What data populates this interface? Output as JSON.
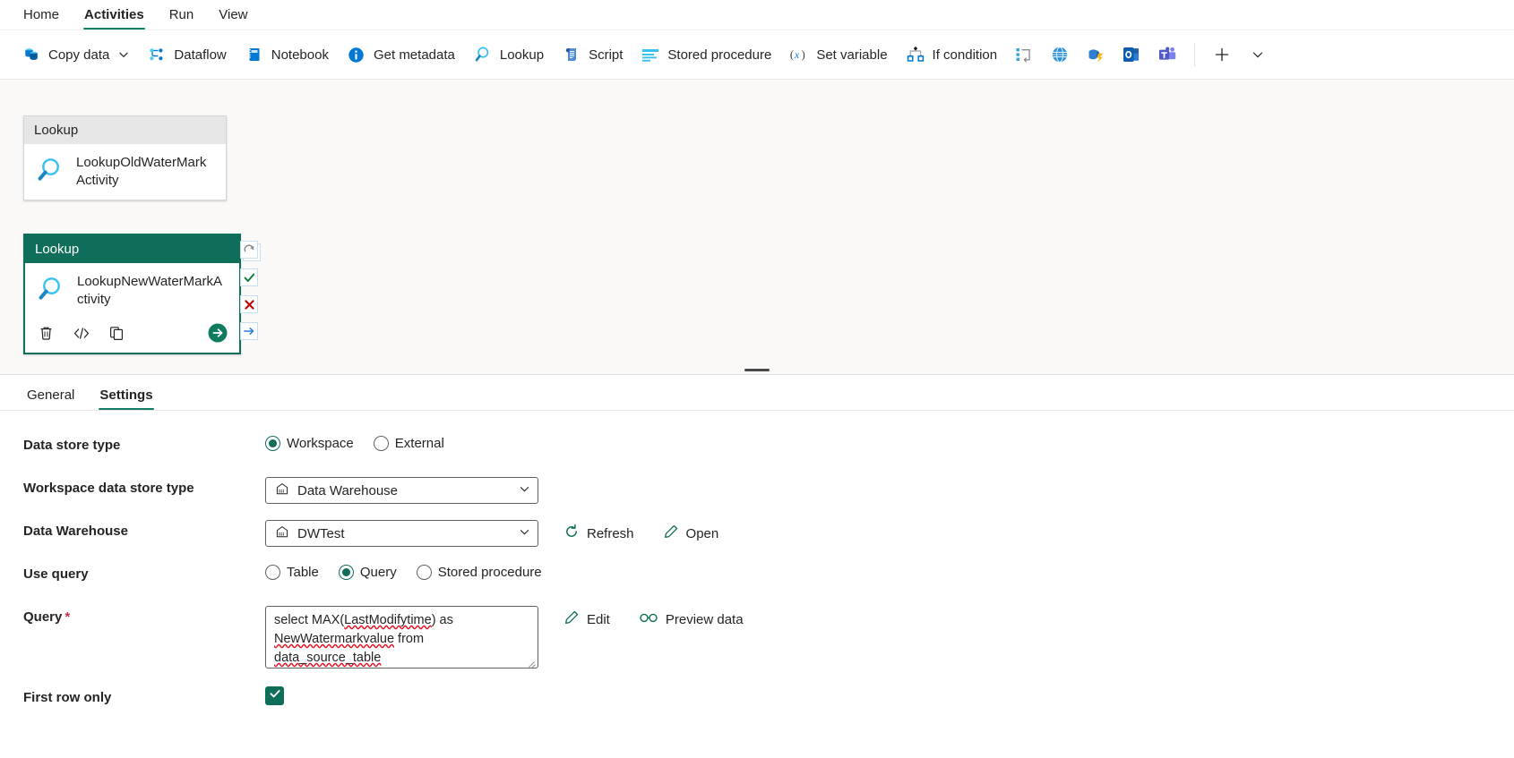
{
  "ribbon": {
    "tabs": [
      {
        "label": "Home",
        "active": false
      },
      {
        "label": "Activities",
        "active": true
      },
      {
        "label": "Run",
        "active": false
      },
      {
        "label": "View",
        "active": false
      }
    ]
  },
  "commandbar": {
    "items": [
      {
        "label": "Copy data",
        "icon": "copy-data-icon",
        "has_chevron": true
      },
      {
        "label": "Dataflow",
        "icon": "dataflow-icon",
        "has_chevron": false
      },
      {
        "label": "Notebook",
        "icon": "notebook-icon",
        "has_chevron": false
      },
      {
        "label": "Get metadata",
        "icon": "info-icon",
        "has_chevron": false
      },
      {
        "label": "Lookup",
        "icon": "magnifier-icon",
        "has_chevron": false
      },
      {
        "label": "Script",
        "icon": "script-icon",
        "has_chevron": false
      },
      {
        "label": "Stored procedure",
        "icon": "stored-procedure-icon",
        "has_chevron": false
      },
      {
        "label": "Set variable",
        "icon": "set-variable-icon",
        "has_chevron": false
      },
      {
        "label": "If condition",
        "icon": "if-condition-icon",
        "has_chevron": false
      }
    ],
    "icon_only": [
      {
        "name": "switch-icon"
      },
      {
        "name": "web-globe-icon"
      },
      {
        "name": "power-automate-icon"
      },
      {
        "name": "outlook-icon"
      },
      {
        "name": "teams-icon"
      }
    ],
    "add_label": "+",
    "add_chevron": "v"
  },
  "canvas": {
    "nodes": [
      {
        "type_label": "Lookup",
        "name": "LookupOldWaterMarkActivity",
        "selected": false,
        "handles": [
          {
            "name": "on-success-handle",
            "glyph": "check"
          }
        ]
      },
      {
        "type_label": "Lookup",
        "name": "LookupNewWaterMarkActivity",
        "selected": true,
        "handles": [
          {
            "name": "on-skip-handle",
            "glyph": "skip"
          },
          {
            "name": "on-success-handle",
            "glyph": "check"
          },
          {
            "name": "on-fail-handle",
            "glyph": "cross"
          },
          {
            "name": "on-completion-handle",
            "glyph": "arrow"
          }
        ],
        "actions": [
          {
            "name": "delete-activity-button",
            "icon": "trash-icon"
          },
          {
            "name": "view-code-button",
            "icon": "code-icon"
          },
          {
            "name": "clone-activity-button",
            "icon": "copy-icon"
          },
          {
            "name": "run-activity-button",
            "icon": "arrow-right-circle-icon"
          }
        ]
      }
    ]
  },
  "panel": {
    "tabs": [
      {
        "label": "General",
        "active": false
      },
      {
        "label": "Settings",
        "active": true
      }
    ],
    "fields": {
      "data_store_type": {
        "label": "Data store type",
        "options": [
          {
            "label": "Workspace",
            "selected": true
          },
          {
            "label": "External",
            "selected": false
          }
        ]
      },
      "workspace_data_store_type": {
        "label": "Workspace data store type",
        "value": "Data Warehouse",
        "icon": "warehouse-icon"
      },
      "data_warehouse": {
        "label": "Data Warehouse",
        "value": "DWTest",
        "icon": "warehouse-icon",
        "refresh_label": "Refresh",
        "open_label": "Open"
      },
      "use_query": {
        "label": "Use query",
        "options": [
          {
            "label": "Table",
            "selected": false
          },
          {
            "label": "Query",
            "selected": true
          },
          {
            "label": "Stored procedure",
            "selected": false
          }
        ]
      },
      "query": {
        "label": "Query",
        "required": "*",
        "line1_a": "select MAX(",
        "line1_b": "LastModifytime",
        "line1_c": ") as",
        "line2_a": "NewWatermarkvalue",
        "line2_b": " from",
        "line3": "data_source_table",
        "edit_label": "Edit",
        "preview_label": "Preview data"
      },
      "first_row_only": {
        "label": "First row only",
        "checked": true
      }
    }
  },
  "colors": {
    "accent_green": "#0f6e59",
    "tab_underline": "#107c63",
    "canvas_bg": "#faf9f8",
    "node_header_unselected": "#e6e6e6",
    "error_red": "#c4314b"
  }
}
